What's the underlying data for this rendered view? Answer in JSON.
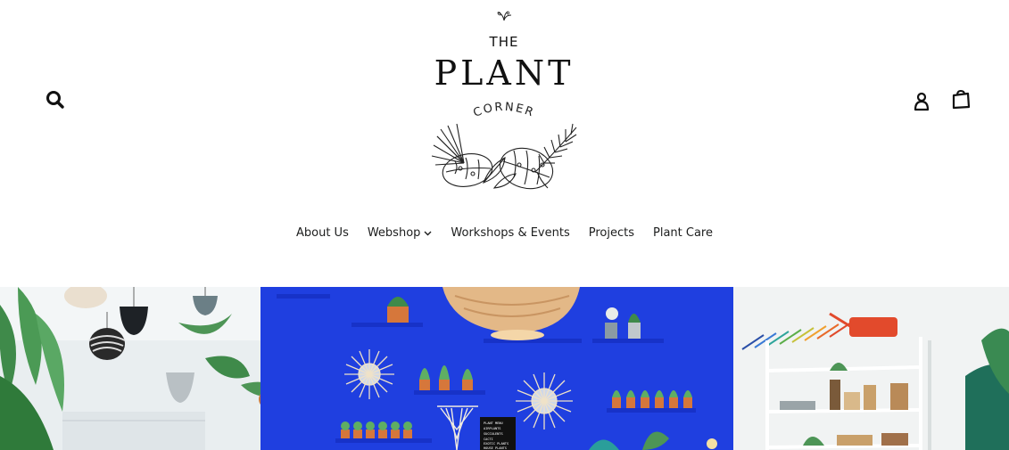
{
  "header": {
    "logo": {
      "line1": "THE",
      "line2": "PLANT",
      "line3": "CORNER"
    },
    "icons": {
      "search": "search-icon",
      "account": "account-icon",
      "cart": "cart-icon"
    }
  },
  "nav": {
    "items": [
      {
        "label": "About Us"
      },
      {
        "label": "Webshop",
        "has_dropdown": true
      },
      {
        "label": "Workshops & Events"
      },
      {
        "label": "Projects"
      },
      {
        "label": "Plant Care"
      }
    ]
  },
  "hero": {
    "wall_color": "#1f3fe0",
    "sign_lines": [
      "PLANT MENU",
      "AIRPLANTS",
      "SUCCULENTS",
      "CACTI",
      "EXOTIC PLANTS",
      "HOUSE PLANTS"
    ]
  }
}
